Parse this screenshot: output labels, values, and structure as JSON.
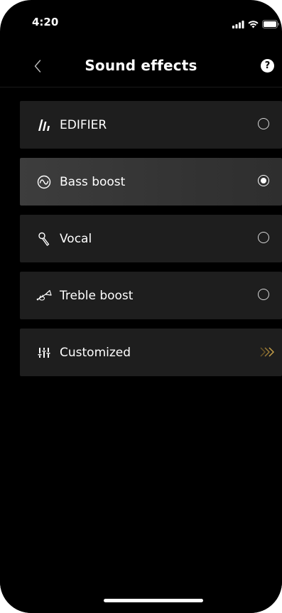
{
  "status_bar": {
    "time": "4:20",
    "icons": [
      "signal-icon",
      "wifi-icon",
      "battery-icon"
    ]
  },
  "nav": {
    "back_icon": "chevron-left-icon",
    "title": "Sound effects",
    "help_label": "?"
  },
  "effects": [
    {
      "label": "EDIFIER",
      "icon": "edifier-logo-icon",
      "control": "radio",
      "selected": false
    },
    {
      "label": "Bass boost",
      "icon": "bass-wave-icon",
      "control": "radio",
      "selected": true
    },
    {
      "label": "Vocal",
      "icon": "microphone-icon",
      "control": "radio",
      "selected": false
    },
    {
      "label": "Treble boost",
      "icon": "trumpet-icon",
      "control": "radio",
      "selected": false
    },
    {
      "label": "Customized",
      "icon": "equalizer-icon",
      "control": "chevron",
      "selected": false
    }
  ],
  "colors": {
    "background": "#000000",
    "card": "#1e1e1e",
    "card_selected": "#3a3a3a",
    "text": "#ffffff",
    "accent_chevron": "#c9a24a"
  }
}
